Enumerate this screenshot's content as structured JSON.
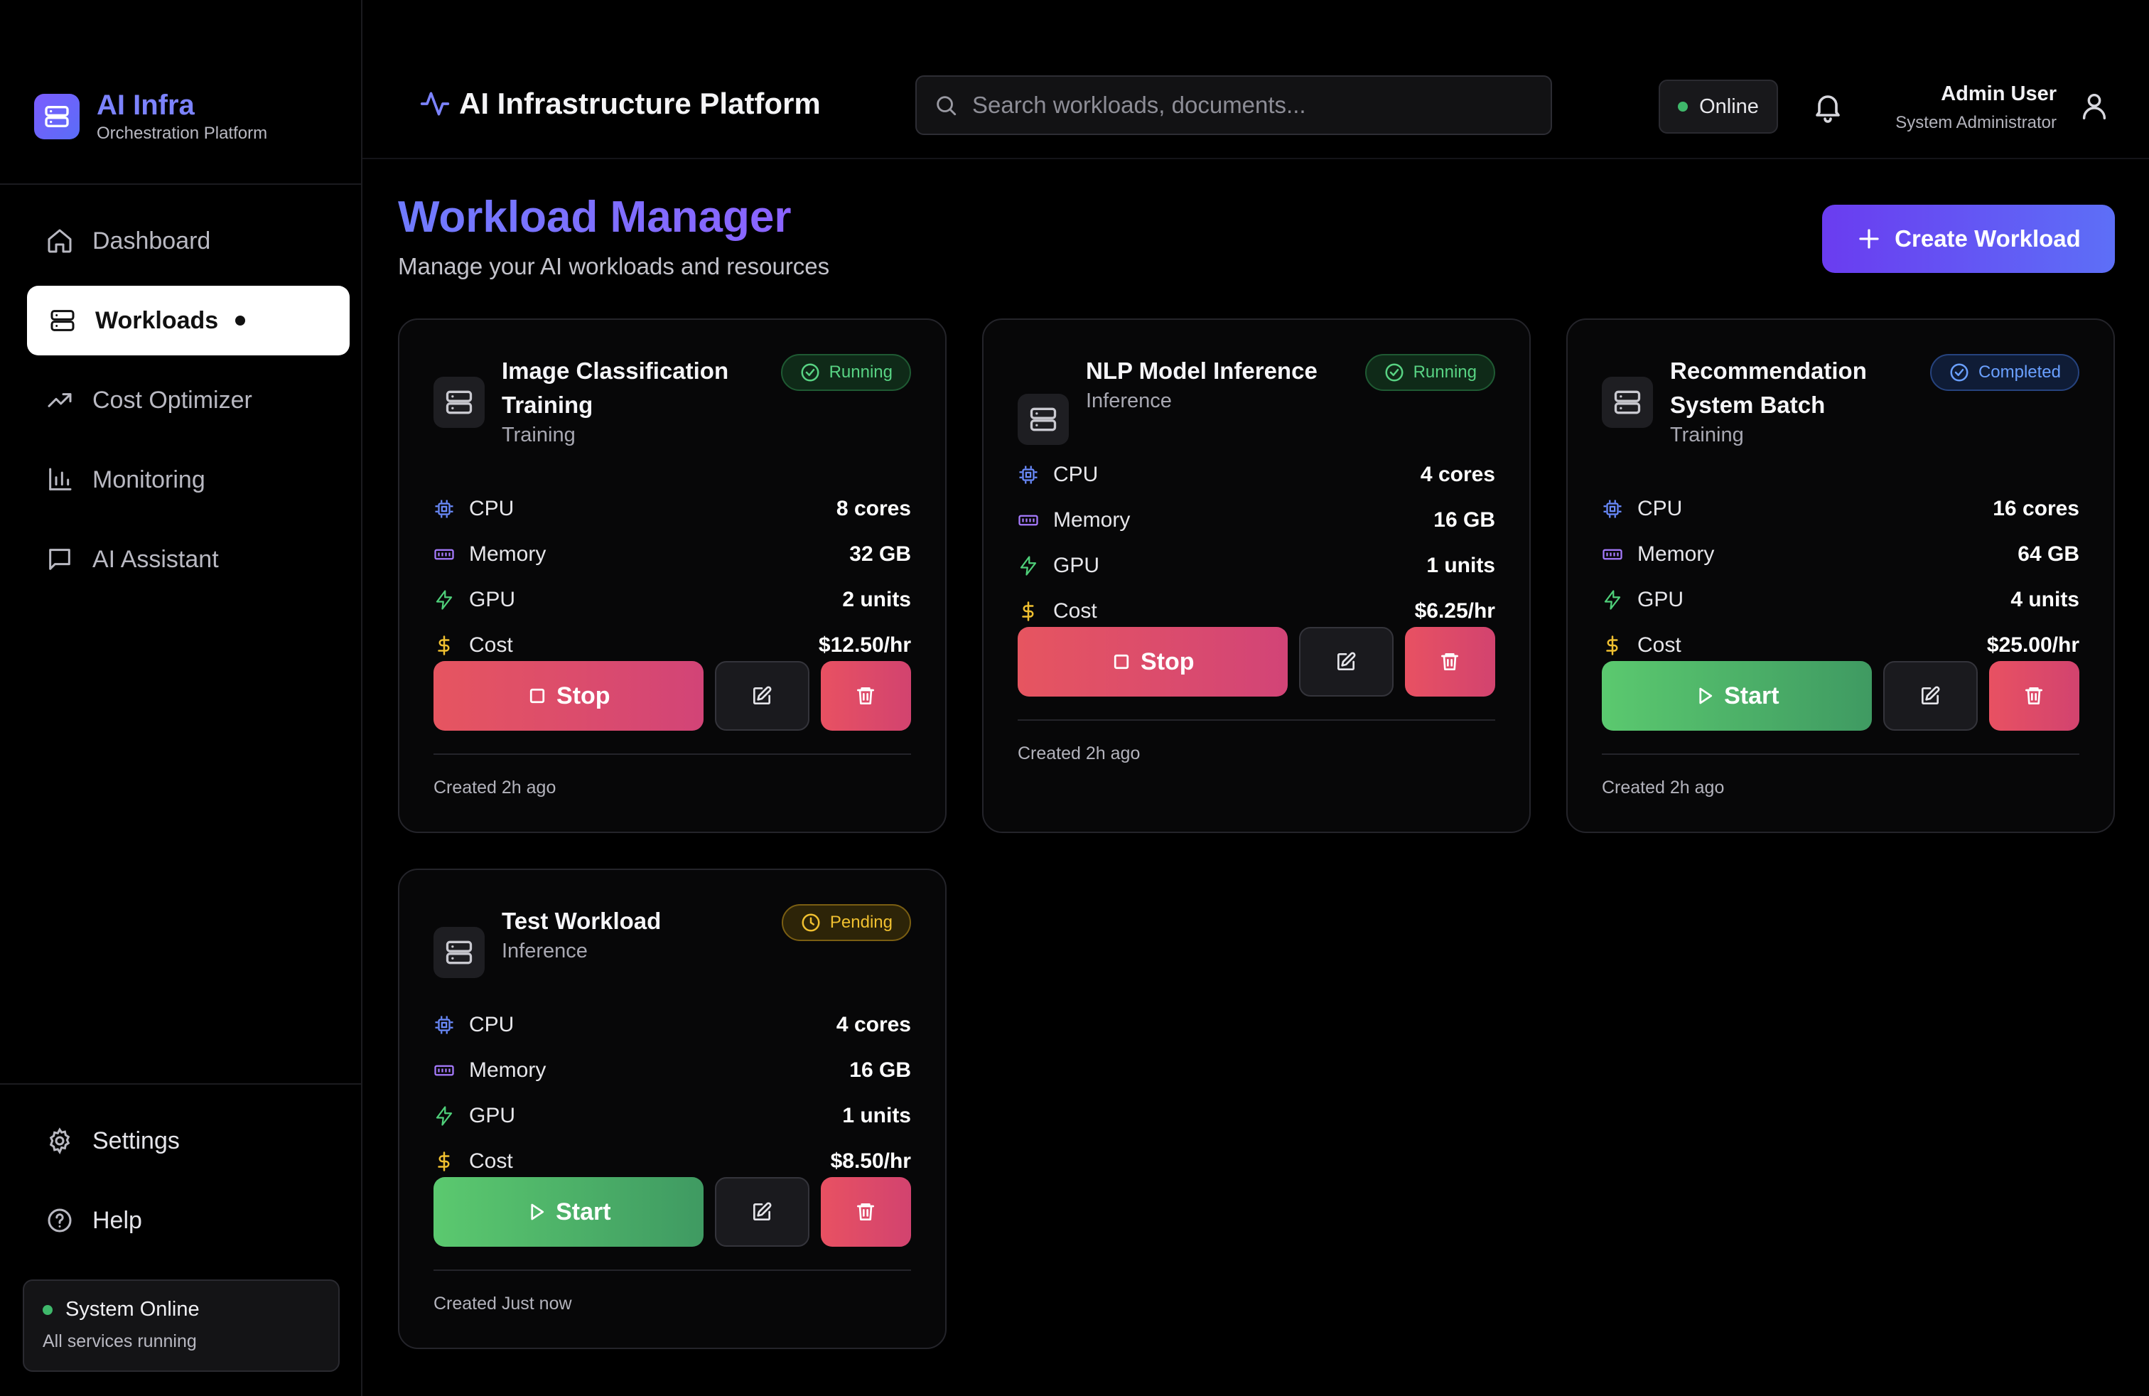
{
  "brand": {
    "title": "AI Infra",
    "subtitle": "Orchestration Platform"
  },
  "nav": {
    "items": [
      {
        "label": "Dashboard",
        "icon": "home-icon"
      },
      {
        "label": "Workloads",
        "icon": "server-icon",
        "active": true
      },
      {
        "label": "Cost Optimizer",
        "icon": "trending-up-icon"
      },
      {
        "label": "Monitoring",
        "icon": "bar-chart-icon"
      },
      {
        "label": "AI Assistant",
        "icon": "message-icon"
      }
    ],
    "bottom": [
      {
        "label": "Settings",
        "icon": "gear-icon"
      },
      {
        "label": "Help",
        "icon": "help-circle-icon"
      }
    ]
  },
  "system_status": {
    "title": "System Online",
    "subtitle": "All services running",
    "color": "#3fb86b"
  },
  "header": {
    "title": "AI Infrastructure Platform",
    "search_placeholder": "Search workloads, documents...",
    "status": "Online",
    "user_name": "Admin User",
    "user_role": "System Administrator"
  },
  "page": {
    "title": "Workload Manager",
    "subtitle": "Manage your AI workloads and resources",
    "create_label": "Create Workload"
  },
  "resource_labels": {
    "cpu": "CPU",
    "memory": "Memory",
    "gpu": "GPU",
    "cost": "Cost"
  },
  "workloads": [
    {
      "name": "Image Classification Training",
      "type": "Training",
      "status": "Running",
      "cpu": "8 cores",
      "memory": "32 GB",
      "gpu": "2 units",
      "cost": "$12.50/hr",
      "action": "Stop",
      "created": "Created 2h ago"
    },
    {
      "name": "NLP Model Inference",
      "type": "Inference",
      "status": "Running",
      "cpu": "4 cores",
      "memory": "16 GB",
      "gpu": "1 units",
      "cost": "$6.25/hr",
      "action": "Stop",
      "created": "Created 2h ago"
    },
    {
      "name": "Recommendation System Batch",
      "type": "Training",
      "status": "Completed",
      "cpu": "16 cores",
      "memory": "64 GB",
      "gpu": "4 units",
      "cost": "$25.00/hr",
      "action": "Start",
      "created": "Created 2h ago"
    },
    {
      "name": "Test Workload",
      "type": "Inference",
      "status": "Pending",
      "cpu": "4 cores",
      "memory": "16 GB",
      "gpu": "1 units",
      "cost": "$8.50/hr",
      "action": "Start",
      "created": "Created Just now"
    }
  ],
  "colors": {
    "accent": "#6a3cf0",
    "running": "#58d383",
    "completed": "#6aa0ff",
    "pending": "#f0c030",
    "stop": "#e65560",
    "start": "#5bc96f"
  }
}
